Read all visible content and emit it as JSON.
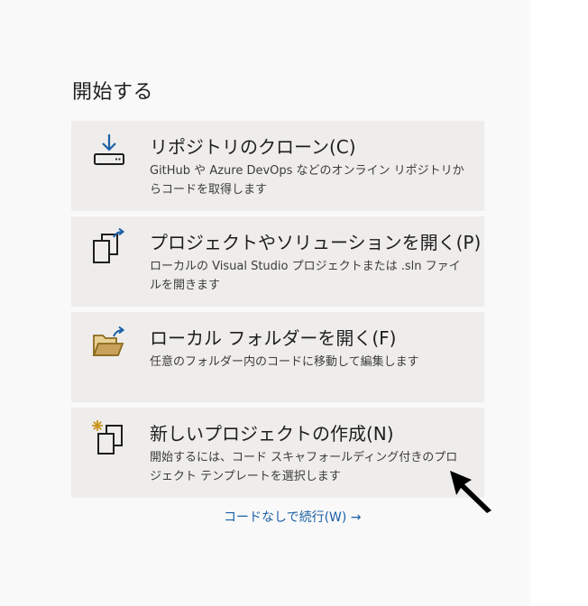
{
  "start_heading": "開始する",
  "cards": [
    {
      "title": "リポジトリのクローン(C)",
      "description": "GitHub や Azure DevOps などのオンライン リポジトリからコードを取得します",
      "icon": "download-icon"
    },
    {
      "title": "プロジェクトやソリューションを開く(P)",
      "description": "ローカルの Visual Studio プロジェクトまたは .sln ファイルを開きます",
      "icon": "open-project-icon"
    },
    {
      "title": "ローカル フォルダーを開く(F)",
      "description": "任意のフォルダー内のコードに移動して編集します",
      "icon": "open-folder-icon"
    },
    {
      "title": "新しいプロジェクトの作成(N)",
      "description": "開始するには、コード スキャフォールディング付きのプロジェクト テンプレートを選択します",
      "icon": "new-project-icon"
    }
  ],
  "continue_link": "コードなしで続行(W) →",
  "colors": {
    "card_background": "#eeedeb",
    "panel_background": "#f9f9f9",
    "accent_blue": "#1a5fa6",
    "folder_gold": "#c8a25a"
  }
}
